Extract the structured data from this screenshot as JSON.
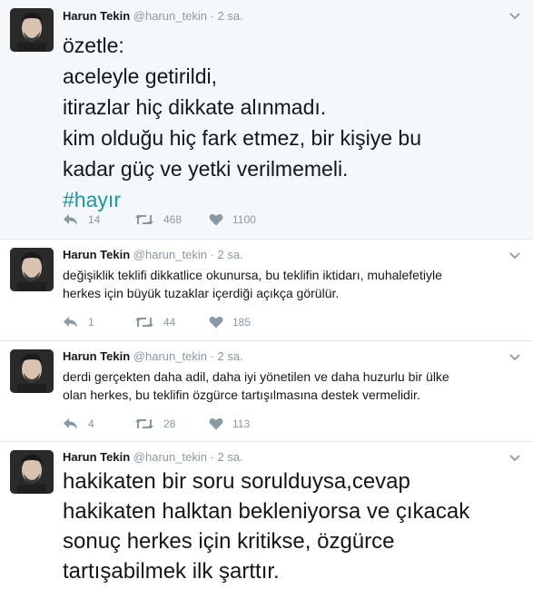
{
  "author": {
    "name": "Harun Tekin",
    "handle": "@harun_tekin",
    "dot": "·"
  },
  "tweets": [
    {
      "time": "2 sa.",
      "lines": [
        "özetle:",
        "aceleyle getirildi,",
        "itirazlar hiç dikkate alınmadı.",
        "kim olduğu hiç fark etmez, bir kişiye bu",
        "kadar güç ve yetki verilmemeli."
      ],
      "hashtag": "#hayır",
      "replies": "14",
      "retweets": "468",
      "likes": "1100"
    },
    {
      "time": "2 sa.",
      "lines": [
        "değişiklik teklifi dikkatlice okunursa, bu teklifin iktidarı, muhalefetiyle",
        "herkes için büyük tuzaklar içerdiği açıkça görülür."
      ],
      "replies": "1",
      "retweets": "44",
      "likes": "185"
    },
    {
      "time": "2 sa.",
      "lines": [
        "derdi gerçekten daha adil, daha iyi yönetilen ve daha huzurlu bir ülke",
        "olan herkes, bu teklifin özgürce tartışılmasına destek vermelidir."
      ],
      "replies": "4",
      "retweets": "28",
      "likes": "113"
    },
    {
      "time": "2 sa.",
      "lines": [
        "hakikaten bir soru sorulduysa,cevap",
        "hakikaten halktan bekleniyorsa ve çıkacak",
        "sonuç herkes için kritikse, özgürce",
        "tartışabilmek ilk şarttır."
      ]
    }
  ],
  "colors": {
    "hashtag": "#1b95a8",
    "meta": "#8899a6",
    "highlight_bg": "#f5f8fa"
  },
  "icons": [
    "reply-icon",
    "retweet-icon",
    "heart-icon",
    "chevron-down-icon"
  ]
}
